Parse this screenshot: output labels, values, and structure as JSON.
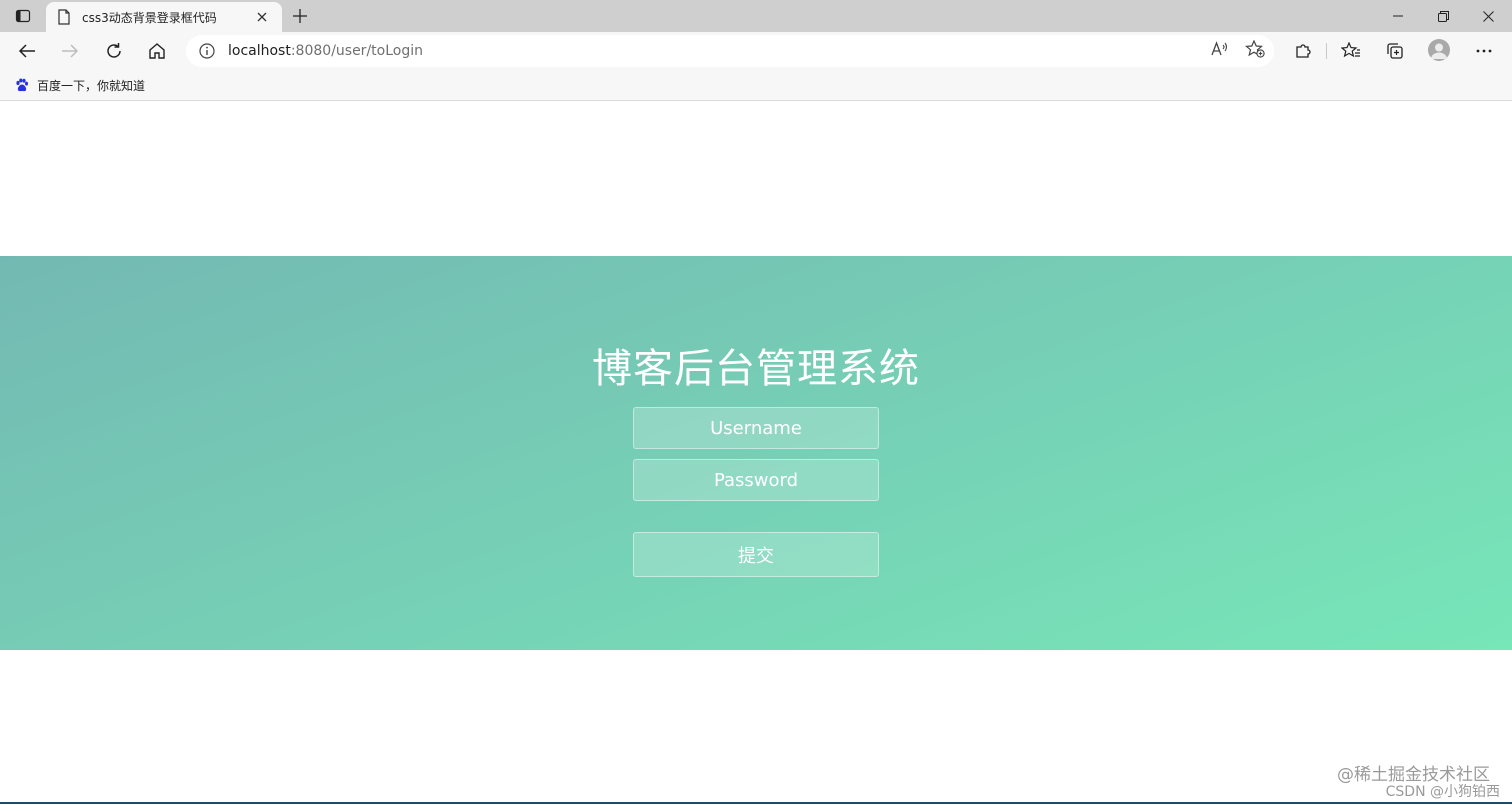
{
  "browser": {
    "tab_title": "css3动态背景登录框代码",
    "url_host": "localhost",
    "url_rest": ":8080/user/toLogin",
    "bookmark_label": "百度一下，你就知道"
  },
  "login": {
    "title": "博客后台管理系统",
    "username_placeholder": "Username",
    "password_placeholder": "Password",
    "submit_label": "提交"
  },
  "watermark": {
    "line1": "@稀土掘金技术社区",
    "line2": "CSDN @小狗铂西"
  }
}
